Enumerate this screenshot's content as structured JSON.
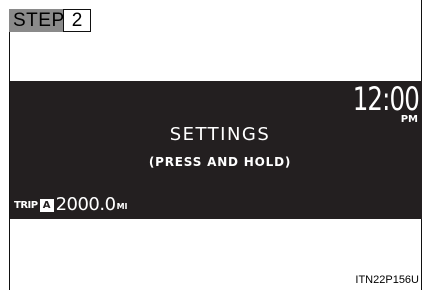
{
  "step": {
    "label": "STEP",
    "number": "2"
  },
  "display": {
    "time": "12:00",
    "ampm": "PM",
    "title": "SETTINGS",
    "subtitle": "(PRESS AND HOLD)",
    "trip_label": "TRIP",
    "trip_id": "A",
    "odometer": "2000.0",
    "unit": "MI"
  },
  "figure_code": "ITN22P156U"
}
